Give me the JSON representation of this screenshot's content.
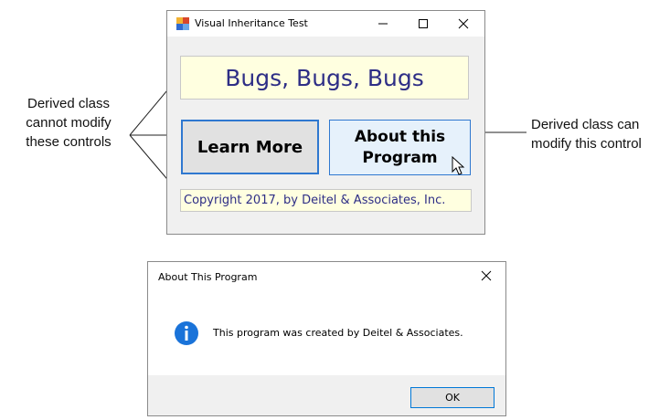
{
  "callouts": {
    "left": "Derived class cannot modify these controls",
    "right": "Derived class can modify this control"
  },
  "main_window": {
    "title": "Visual Inheritance Test",
    "app_icon": "form-app-icon",
    "caption_buttons": [
      "minimize-icon",
      "maximize-icon",
      "close-icon"
    ],
    "banner_text": "Bugs, Bugs, Bugs",
    "learn_more_label": "Learn More",
    "about_label": "About this Program",
    "copyright_text": "Copyright 2017, by Deitel & Associates, Inc.",
    "colors": {
      "banner_bg": "#ffffe0",
      "banner_text": "#2e2e86",
      "button_border": "#2f78d0",
      "about_bg": "#e6f1fb"
    }
  },
  "dialog": {
    "title": "About This Program",
    "icon": "info-icon",
    "message": "This program was created by Deitel & Associates.",
    "ok_label": "OK",
    "colors": {
      "info_icon": "#1a73d9"
    }
  }
}
